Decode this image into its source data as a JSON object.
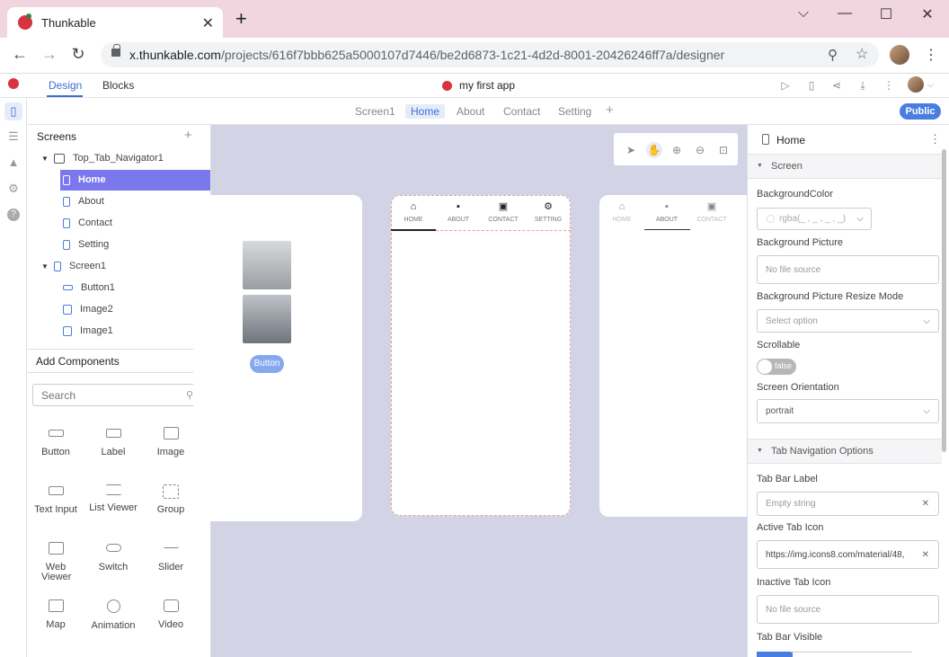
{
  "browser": {
    "tab_title": "Thunkable",
    "url_host": "x.thunkable.com",
    "url_path": "/projects/616f7bbb625a5000107d7446/be2d6873-1c21-4d2d-8001-20426246ff7a/designer",
    "new_tab": "+",
    "close_tab": "✕"
  },
  "appbar": {
    "design_tab": "Design",
    "blocks_tab": "Blocks",
    "app_name": "my first app"
  },
  "screen_tabs": [
    "Screen1",
    "Home",
    "About",
    "Contact",
    "Setting"
  ],
  "screen_tabs_add": "+",
  "public_label": "Public",
  "left": {
    "screens_heading": "Screens",
    "tree": [
      {
        "label": "Top_Tab_Navigator1"
      },
      {
        "label": "Home"
      },
      {
        "label": "About"
      },
      {
        "label": "Contact"
      },
      {
        "label": "Setting"
      },
      {
        "label": "Screen1"
      },
      {
        "label": "Button1"
      },
      {
        "label": "Image2"
      },
      {
        "label": "Image1"
      }
    ],
    "add_components_heading": "Add Components",
    "search_placeholder": "Search",
    "components": [
      "Button",
      "Label",
      "Image",
      "Text Input",
      "List Viewer",
      "Group",
      "Web Viewer",
      "Switch",
      "Slider",
      "Map",
      "Animation",
      "Video"
    ]
  },
  "canvas": {
    "button_label": "Button",
    "tabs": [
      "HOME",
      "ABOUT",
      "CONTACT",
      "SETTING"
    ],
    "tabs_preview": [
      "HOME",
      "ABOUT",
      "CONTACT"
    ]
  },
  "right": {
    "title": "Home",
    "section_screen": "Screen",
    "bgcolor_label": "BackgroundColor",
    "bgcolor_value": "rgba(_ , _ , _ , _)",
    "bgpic_label": "Background Picture",
    "bgpic_value": "No file source",
    "resize_label": "Background Picture Resize Mode",
    "resize_value": "Select option",
    "scrollable_label": "Scrollable",
    "scrollable_value": "false",
    "orientation_label": "Screen Orientation",
    "orientation_value": "portrait",
    "section_tabnav": "Tab Navigation Options",
    "tablabel_label": "Tab Bar Label",
    "tablabel_value": "Empty string",
    "active_icon_label": "Active Tab Icon",
    "active_icon_value": "https://img.icons8.com/material/48,",
    "inactive_icon_label": "Inactive Tab Icon",
    "inactive_icon_value": "No file source",
    "tabbar_visible_label": "Tab Bar Visible"
  },
  "colors": {
    "accent": "#3b6fd8",
    "selection": "#7b78ee",
    "canvas": "#d2d4e5",
    "tabbar": "#f2d6df"
  }
}
